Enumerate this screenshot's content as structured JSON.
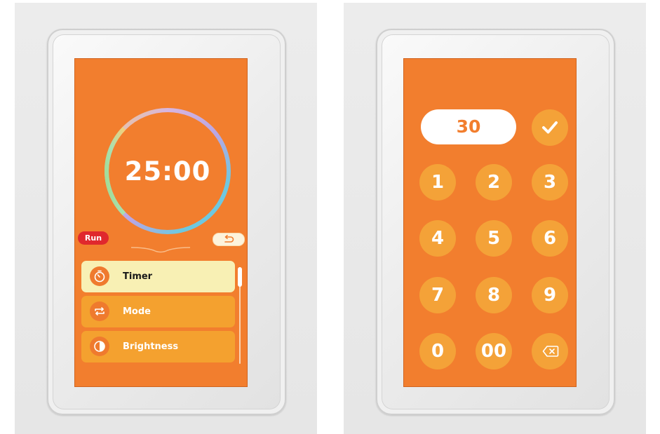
{
  "left_panel": {
    "timer": {
      "display": "25:00"
    },
    "status_badge": "Run",
    "menu": {
      "items": [
        {
          "label": "Timer",
          "icon": "stopwatch-icon",
          "active": true
        },
        {
          "label": "Mode",
          "icon": "repeat-icon",
          "active": false
        },
        {
          "label": "Brightness",
          "icon": "contrast-icon",
          "active": false
        }
      ]
    },
    "icons": {
      "back": "return-arrow-icon"
    }
  },
  "right_panel": {
    "input_value": "30",
    "keypad": {
      "keys": [
        "1",
        "2",
        "3",
        "4",
        "5",
        "6",
        "7",
        "8",
        "9",
        "0",
        "00"
      ],
      "confirm_icon": "checkmark-icon",
      "backspace_icon": "backspace-icon"
    }
  },
  "colors": {
    "screen_background": "#f27e2e",
    "button": "#f4a238",
    "menu_item": "#f4a12f",
    "menu_item_active": "#f8f0b4",
    "run_badge": "#e0282d",
    "ring_gradient": [
      "#9fdc8a",
      "#f5cf7a",
      "#c8a8e0",
      "#6ec8e0"
    ]
  }
}
